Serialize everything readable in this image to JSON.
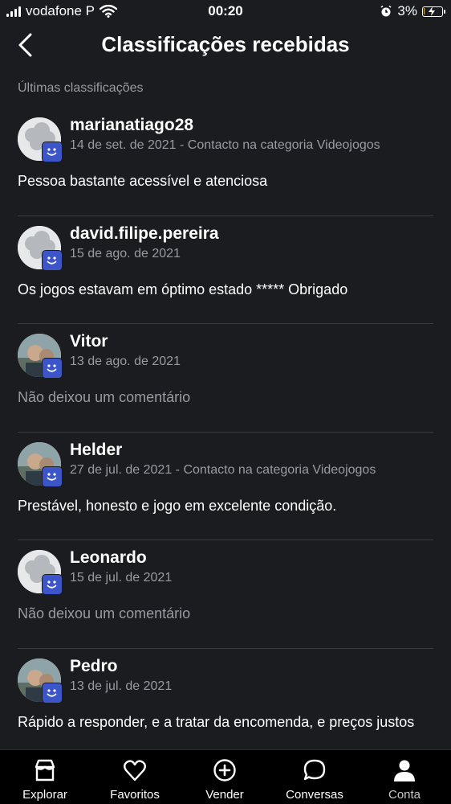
{
  "status_bar": {
    "carrier": "vodafone P",
    "time": "00:20",
    "battery": "3%"
  },
  "header": {
    "title": "Classificações recebidas"
  },
  "section": {
    "label": "Últimas classificações"
  },
  "reviews": [
    {
      "user": "marianatiago28",
      "meta": "14 de set. de 2021 - Contacto na categoria Videojogos",
      "comment": "Pessoa bastante acessível e atenciosa",
      "muted": false,
      "avatar": "placeholder"
    },
    {
      "user": "david.filipe.pereira",
      "meta": "15 de ago. de 2021",
      "comment": "Os jogos estavam em óptimo estado ***** Obrigado",
      "muted": false,
      "avatar": "placeholder"
    },
    {
      "user": "Vitor",
      "meta": "13 de ago. de 2021",
      "comment": "Não deixou um comentário",
      "muted": true,
      "avatar": "photo"
    },
    {
      "user": "Helder",
      "meta": "27 de jul. de 2021 - Contacto na categoria Videojogos",
      "comment": "Prestável, honesto e jogo em excelente condição.",
      "muted": false,
      "avatar": "photo"
    },
    {
      "user": "Leonardo",
      "meta": "15 de jul. de 2021",
      "comment": "Não deixou um comentário",
      "muted": true,
      "avatar": "placeholder"
    },
    {
      "user": "Pedro",
      "meta": "13 de jul. de 2021",
      "comment": "Rápido a responder, e a tratar da encomenda, e preços justos",
      "muted": false,
      "avatar": "photo"
    }
  ],
  "tabs": [
    {
      "label": "Explorar",
      "icon": "store-icon"
    },
    {
      "label": "Favoritos",
      "icon": "heart-icon"
    },
    {
      "label": "Vender",
      "icon": "plus-circle-icon"
    },
    {
      "label": "Conversas",
      "icon": "chat-bubble-icon"
    },
    {
      "label": "Conta",
      "icon": "person-icon"
    }
  ],
  "colors": {
    "background": "#1b1c20",
    "badge": "#3c55c8",
    "muted_text": "#9a9aa0"
  },
  "battery_level": 0.03
}
